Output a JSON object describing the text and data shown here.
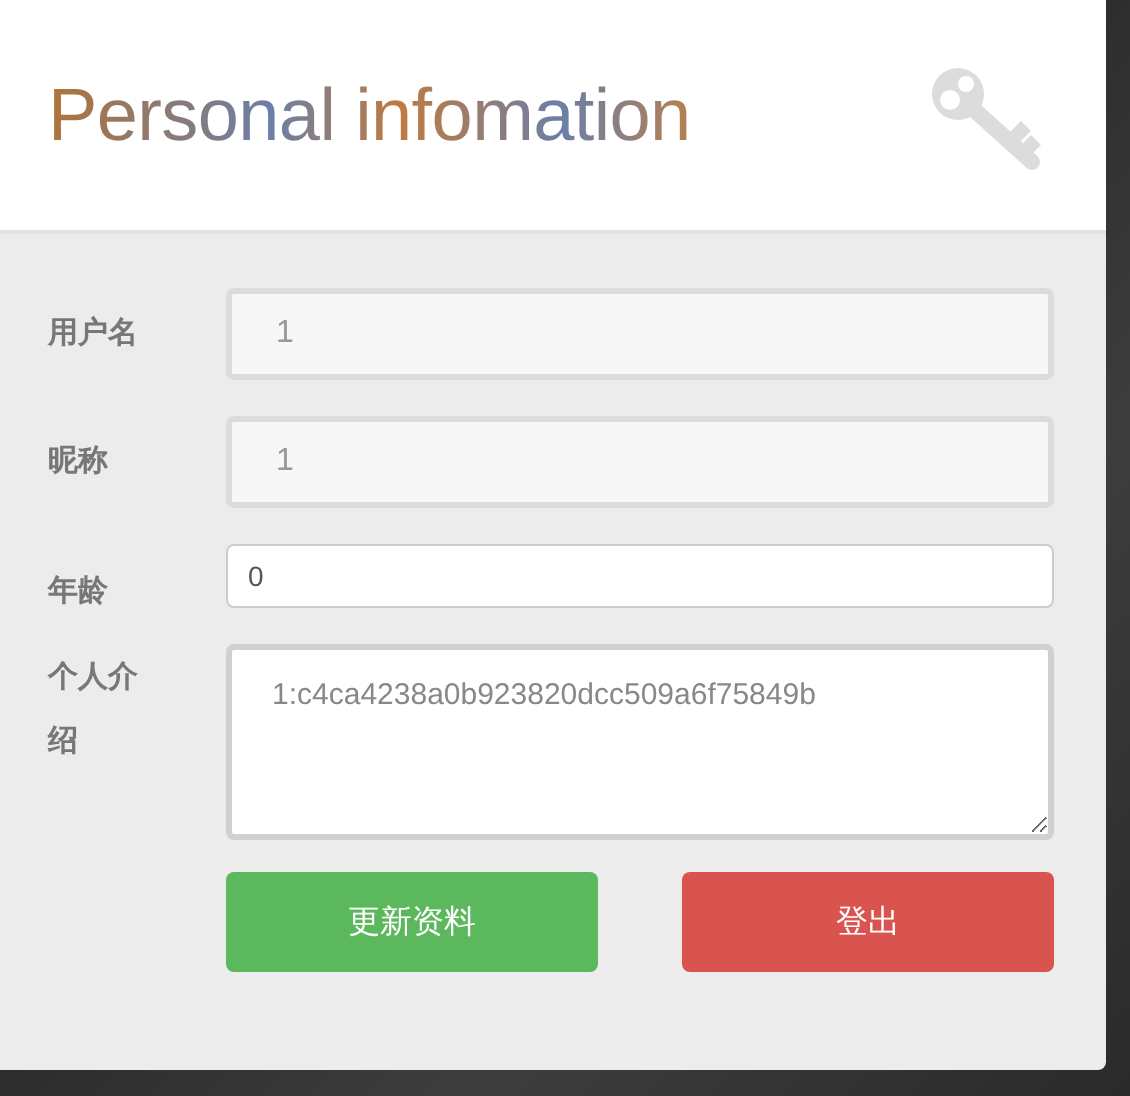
{
  "header": {
    "title": "Personal infomation"
  },
  "fields": [
    {
      "label": "用户名",
      "value": "1",
      "kind": "text",
      "disabled": true
    },
    {
      "label": "昵称",
      "value": "1",
      "kind": "text",
      "disabled": true
    },
    {
      "label": "年龄",
      "value": "0",
      "kind": "number",
      "disabled": false
    },
    {
      "label": "个人介绍",
      "value": "1:c4ca4238a0b923820dcc509a6f75849b",
      "kind": "textarea",
      "disabled": false
    }
  ],
  "buttons": [
    {
      "label": "更新资料",
      "kind": "success"
    },
    {
      "label": "登出",
      "kind": "danger"
    }
  ]
}
